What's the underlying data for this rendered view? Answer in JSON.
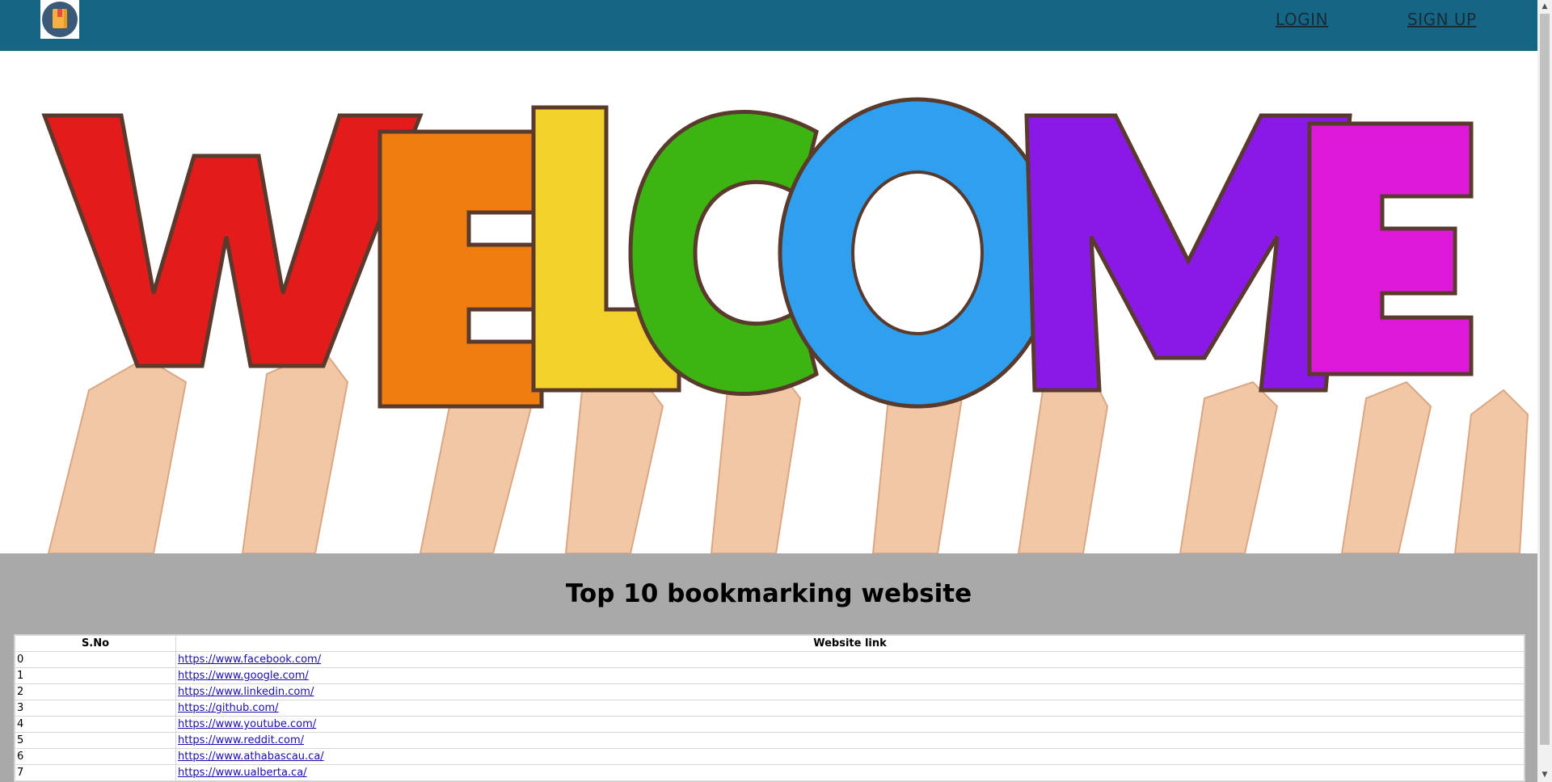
{
  "header": {
    "logo_icon": "bookmark-book-icon",
    "nav": {
      "login": "LOGIN",
      "signup": "SIGN UP"
    },
    "colors": {
      "bar": "#156585",
      "nav_text": "#1b2b38"
    }
  },
  "hero": {
    "banner_text": "WELCOME",
    "letter_colors": [
      "#e31b1b",
      "#f07d10",
      "#f2d22a",
      "#3cb512",
      "#2f9ff0",
      "#8a19e8",
      "#dd18d8"
    ]
  },
  "section": {
    "title": "Top 10 bookmarking website",
    "background": "#a9a9a9",
    "table": {
      "headers": [
        "S.No",
        "Website link"
      ],
      "rows": [
        {
          "sno": "0",
          "link": "https://www.facebook.com/"
        },
        {
          "sno": "1",
          "link": "https://www.google.com/"
        },
        {
          "sno": "2",
          "link": "https://www.linkedin.com/"
        },
        {
          "sno": "3",
          "link": "https://github.com/"
        },
        {
          "sno": "4",
          "link": "https://www.youtube.com/"
        },
        {
          "sno": "5",
          "link": "https://www.reddit.com/"
        },
        {
          "sno": "6",
          "link": "https://www.athabascau.ca/"
        },
        {
          "sno": "7",
          "link": "https://www.ualberta.ca/"
        }
      ]
    }
  },
  "scrollbar": {
    "up_icon": "scroll-up-arrow-icon",
    "down_icon": "scroll-down-arrow-icon"
  }
}
